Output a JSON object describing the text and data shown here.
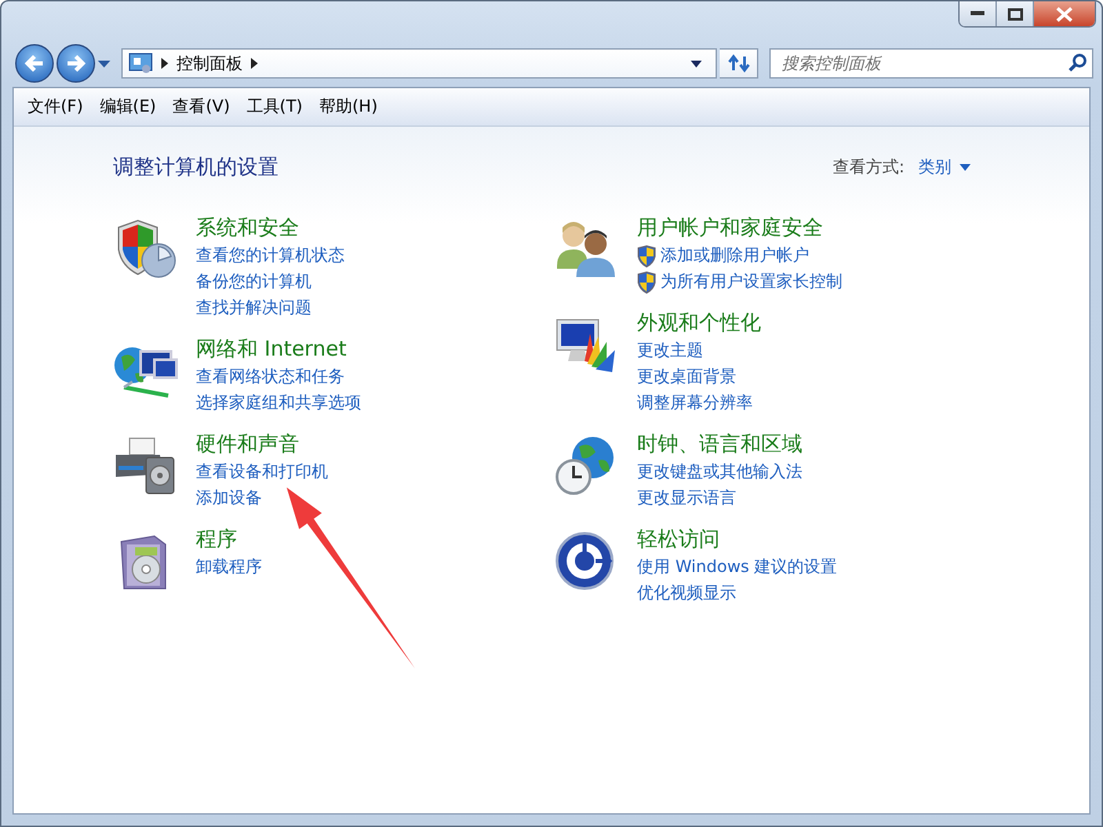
{
  "address_bar": {
    "path": "控制面板"
  },
  "search": {
    "placeholder": "搜索控制面板"
  },
  "menu": [
    "文件(F)",
    "编辑(E)",
    "查看(V)",
    "工具(T)",
    "帮助(H)"
  ],
  "heading": "调整计算机的设置",
  "view_by": {
    "label": "查看方式:",
    "value": "类别"
  },
  "columns": [
    [
      {
        "title": "系统和安全",
        "links": [
          {
            "text": "查看您的计算机状态",
            "admin": false
          },
          {
            "text": "备份您的计算机",
            "admin": false
          },
          {
            "text": "查找并解决问题",
            "admin": false
          }
        ]
      },
      {
        "title": "网络和 Internet",
        "links": [
          {
            "text": "查看网络状态和任务",
            "admin": false
          },
          {
            "text": "选择家庭组和共享选项",
            "admin": false
          }
        ]
      },
      {
        "title": "硬件和声音",
        "links": [
          {
            "text": "查看设备和打印机",
            "admin": false
          },
          {
            "text": "添加设备",
            "admin": false
          }
        ]
      },
      {
        "title": "程序",
        "links": [
          {
            "text": "卸载程序",
            "admin": false
          }
        ]
      }
    ],
    [
      {
        "title": "用户帐户和家庭安全",
        "links": [
          {
            "text": "添加或删除用户帐户",
            "admin": true
          },
          {
            "text": "为所有用户设置家长控制",
            "admin": true
          }
        ]
      },
      {
        "title": "外观和个性化",
        "links": [
          {
            "text": "更改主题",
            "admin": false
          },
          {
            "text": "更改桌面背景",
            "admin": false
          },
          {
            "text": "调整屏幕分辨率",
            "admin": false
          }
        ]
      },
      {
        "title": "时钟、语言和区域",
        "links": [
          {
            "text": "更改键盘或其他输入法",
            "admin": false
          },
          {
            "text": "更改显示语言",
            "admin": false
          }
        ]
      },
      {
        "title": "轻松访问",
        "links": [
          {
            "text": "使用 Windows 建议的设置",
            "admin": false
          },
          {
            "text": "优化视频显示",
            "admin": false
          }
        ]
      }
    ]
  ]
}
